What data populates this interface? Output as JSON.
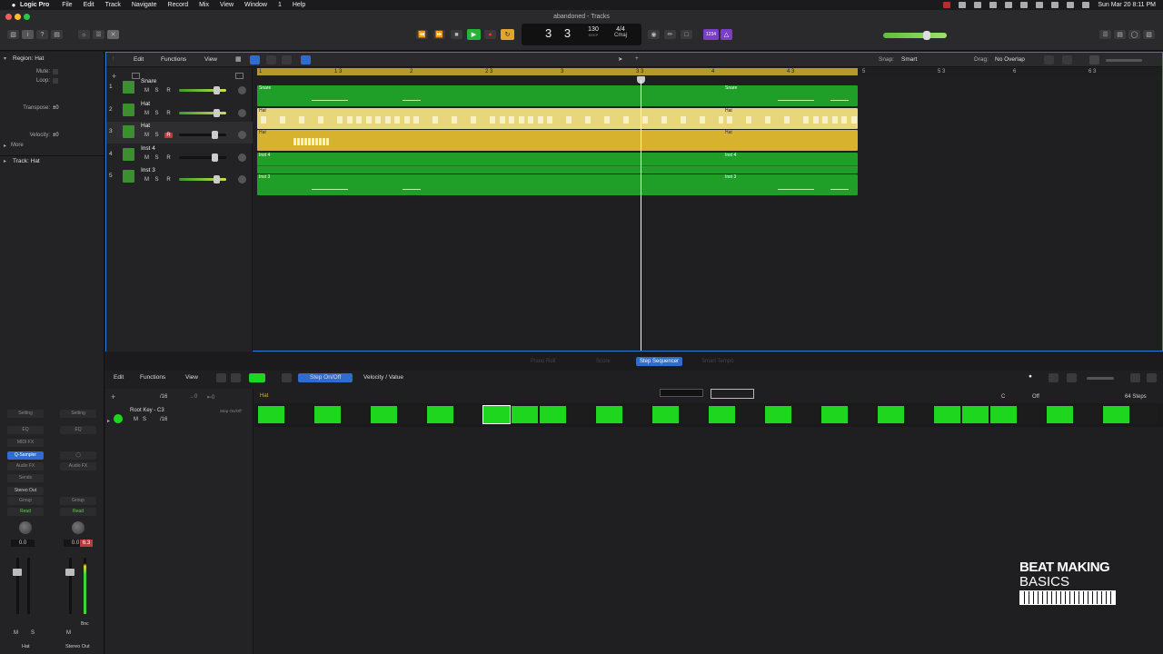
{
  "menubar": {
    "app_name": "Logic Pro",
    "items": [
      "File",
      "Edit",
      "Track",
      "Navigate",
      "Record",
      "Mix",
      "View",
      "Window",
      "1",
      "Help"
    ],
    "clock": "Sun Mar 20  8:11 PM"
  },
  "window": {
    "title": "abandoned - Tracks"
  },
  "transport": {
    "position": "3 3",
    "tempo": "130",
    "tempo_label": "KEEP",
    "signature": "4/4",
    "key": "Cmaj",
    "count_in": "1234"
  },
  "inspector": {
    "region_header": "Region: Hat",
    "fields": [
      {
        "label": "Mute:",
        "value": ""
      },
      {
        "label": "Loop:",
        "value": ""
      },
      {
        "label": "Transpose:",
        "value": "±0"
      },
      {
        "label": "Velocity:",
        "value": "±0"
      }
    ],
    "more_label": "More",
    "track_header": "Track: Hat",
    "strip_left": {
      "setting": "Setting",
      "eq": "EQ",
      "midi_fx": "MIDI FX",
      "instrument": "Q-Sampler",
      "audio_fx": "Audio FX",
      "sends": "Sends",
      "output": "Stereo Out",
      "group": "Group",
      "automation": "Read",
      "value": "0.0",
      "m": "M",
      "s": "S",
      "name": "Hat"
    },
    "strip_right": {
      "setting": "Setting",
      "eq": "EQ",
      "audio_fx": "Audio FX",
      "group": "Group",
      "automation": "Read",
      "value": "0.0",
      "peak": "6.3",
      "bnc": "Bnc",
      "m": "M",
      "name": "Stereo Out"
    }
  },
  "tracks_toolbar": {
    "edit": "Edit",
    "functions": "Functions",
    "view": "View",
    "snap_label": "Snap:",
    "snap_value": "Smart",
    "drag_label": "Drag:",
    "drag_value": "No Overlap"
  },
  "ruler": {
    "marks": [
      "1",
      "1 3",
      "2",
      "2 3",
      "3",
      "3 3",
      "4",
      "4 3",
      "5",
      "5 3",
      "6",
      "6 3"
    ]
  },
  "tracks": [
    {
      "num": "1",
      "name": "Snare",
      "rec": false,
      "vol_on": true
    },
    {
      "num": "2",
      "name": "Hat",
      "rec": false,
      "vol_on": true
    },
    {
      "num": "3",
      "name": "Hat",
      "rec": true,
      "vol_on": false
    },
    {
      "num": "4",
      "name": "Inst 4",
      "rec": false,
      "vol_on": false
    },
    {
      "num": "5",
      "name": "Inst 3",
      "rec": false,
      "vol_on": true
    }
  ],
  "track_buttons": {
    "m": "M",
    "s": "S",
    "r": "R"
  },
  "regions": [
    {
      "name": "Snare"
    },
    {
      "name": "Snare"
    },
    {
      "name": "Hat"
    },
    {
      "name": "Hat"
    },
    {
      "name": "Hat"
    },
    {
      "name": "Hat"
    },
    {
      "name": "Inst 4"
    },
    {
      "name": "Inst 4"
    },
    {
      "name": "Inst 3"
    },
    {
      "name": "Inst 3"
    }
  ],
  "lower_tabs": [
    "Piano Roll",
    "Score",
    "Step Sequencer",
    "Smart Tempo"
  ],
  "step_sequencer": {
    "edit": "Edit",
    "functions": "Functions",
    "view": "View",
    "mode_on_off": "Step On/Off",
    "mode_velocity": "Velocity / Value",
    "pattern_name": "Hat",
    "rate": "/16",
    "key": "C",
    "swing": "Off",
    "steps": "64 Steps",
    "row_name": "Root Key - C3",
    "row_mode": "Step On/Off",
    "row_rate": "/16",
    "row_m": "M",
    "row_s": "S",
    "pattern": [
      1,
      0,
      1,
      0,
      1,
      0,
      1,
      0,
      2,
      1,
      1,
      0,
      1,
      0,
      1,
      0,
      1,
      0,
      1,
      0,
      1,
      0,
      1,
      0,
      1,
      1,
      1,
      0,
      1,
      0,
      1,
      0
    ]
  },
  "logo": {
    "line1": "BEAT MAKING",
    "line2": "BASICS"
  },
  "colors": {
    "accent": "#2f6bd0",
    "region_green": "#1f9e28",
    "region_yellow": "#d6b22f",
    "step_on": "#1fd61f"
  }
}
